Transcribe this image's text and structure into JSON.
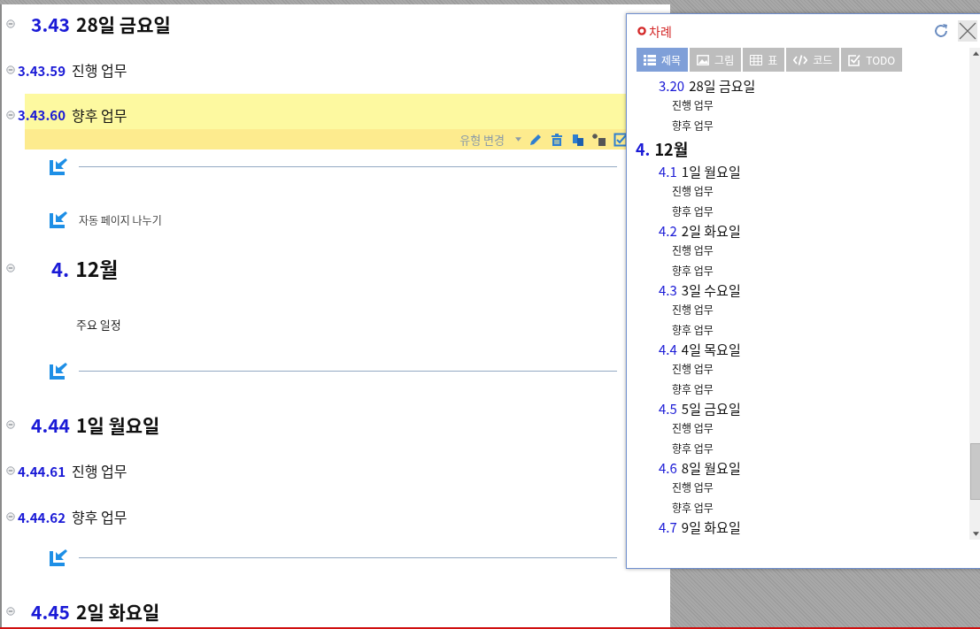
{
  "document": {
    "blocks": [
      {
        "kind": "section",
        "number": "3.43",
        "title": "28일 금요일",
        "selected": false
      },
      {
        "kind": "subsection",
        "number": "3.43.59",
        "title": "진행 업무",
        "selected": false
      },
      {
        "kind": "subsection",
        "number": "3.43.60",
        "title": "향후 업무",
        "selected": true
      },
      {
        "kind": "separator"
      },
      {
        "kind": "page_break",
        "text": "자동 페이지 나누기"
      },
      {
        "kind": "chapter",
        "number": "4.",
        "title": "12월",
        "selected": false
      },
      {
        "kind": "paragraph",
        "text": "주요 일정"
      },
      {
        "kind": "separator"
      },
      {
        "kind": "section",
        "number": "4.44",
        "title": "1일 월요일",
        "selected": false
      },
      {
        "kind": "subsection",
        "number": "4.44.61",
        "title": "진행 업무",
        "selected": false
      },
      {
        "kind": "subsection",
        "number": "4.44.62",
        "title": "향후 업무",
        "selected": false
      },
      {
        "kind": "separator"
      },
      {
        "kind": "section",
        "number": "4.45",
        "title": "2일 화요일",
        "selected": false
      }
    ],
    "block_toolbar": {
      "type_label": "유형 변경"
    }
  },
  "toc": {
    "title": "차례",
    "tabs": [
      {
        "label": "제목",
        "selected": true
      },
      {
        "label": "그림",
        "selected": false
      },
      {
        "label": "표",
        "selected": false
      },
      {
        "label": "코드",
        "selected": false
      },
      {
        "label": "TODO",
        "selected": false
      }
    ],
    "items": [
      {
        "children": [
          {
            "number": "3.20",
            "title": "28일 금요일",
            "children": [
              {
                "title": "진행 업무"
              },
              {
                "title": "향후 업무"
              }
            ]
          }
        ]
      },
      {
        "number": "4.",
        "title": "12월",
        "children": [
          {
            "number": "4.1",
            "title": "1일 월요일",
            "children": [
              {
                "title": "진행 업무"
              },
              {
                "title": "향후 업무"
              }
            ]
          },
          {
            "number": "4.2",
            "title": "2일 화요일",
            "children": [
              {
                "title": "진행 업무"
              },
              {
                "title": "향후 업무"
              }
            ]
          },
          {
            "number": "4.3",
            "title": "3일 수요일",
            "children": [
              {
                "title": "진행 업무"
              },
              {
                "title": "향후 업무"
              }
            ]
          },
          {
            "number": "4.4",
            "title": "4일 목요일",
            "children": [
              {
                "title": "진행 업무"
              },
              {
                "title": "향후 업무"
              }
            ]
          },
          {
            "number": "4.5",
            "title": "5일 금요일",
            "children": [
              {
                "title": "진행 업무"
              },
              {
                "title": "향후 업무"
              }
            ]
          },
          {
            "number": "4.6",
            "title": "8일 월요일",
            "children": [
              {
                "title": "진행 업무"
              },
              {
                "title": "향후 업무"
              }
            ]
          },
          {
            "number": "4.7",
            "title": "9일 화요일"
          }
        ]
      }
    ]
  }
}
